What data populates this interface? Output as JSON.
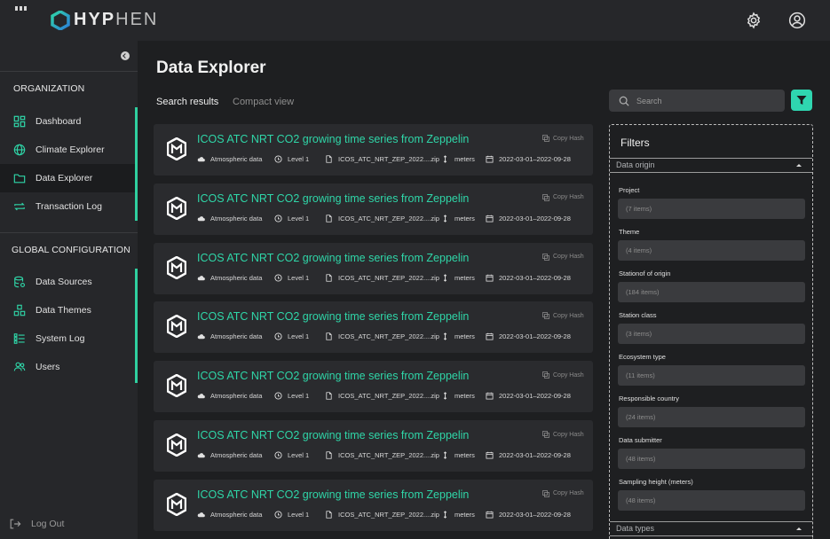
{
  "app": {
    "logo_bold": "HYP",
    "logo_light": "HEN"
  },
  "sidebar": {
    "sections": {
      "organization": "ORGANIZATION",
      "global": "GLOBAL CONFIGURATION"
    },
    "org_items": [
      {
        "label": "Dashboard",
        "icon": "dashboard-icon"
      },
      {
        "label": "Climate Explorer",
        "icon": "globe-icon"
      },
      {
        "label": "Data Explorer",
        "icon": "folder-icon",
        "active": true
      },
      {
        "label": "Transaction Log",
        "icon": "repeat-icon"
      }
    ],
    "config_items": [
      {
        "label": "Data Sources",
        "icon": "database-icon"
      },
      {
        "label": "Data Themes",
        "icon": "cubes-icon"
      },
      {
        "label": "System Log",
        "icon": "list-icon"
      },
      {
        "label": "Users",
        "icon": "users-icon"
      }
    ],
    "logout": "Log Out"
  },
  "main": {
    "title": "Data Explorer",
    "tabs": [
      {
        "label": "Search results",
        "active": true
      },
      {
        "label": "Compact view",
        "active": false
      }
    ],
    "search_placeholder": "Search"
  },
  "results": [
    {
      "title": "ICOS ATC NRT CO2 growing time series from Zeppelin",
      "copy": "Copy Hash",
      "category": "Atmospheric data",
      "level": "Level 1",
      "file": "ICOS_ATC_NRT_ZEP_2022....zip",
      "unit": "meters",
      "dates": "2022-03-01–2022-09-28"
    },
    {
      "title": "ICOS ATC NRT CO2 growing time series from Zeppelin",
      "copy": "Copy Hash",
      "category": "Atmospheric data",
      "level": "Level 1",
      "file": "ICOS_ATC_NRT_ZEP_2022....zip",
      "unit": "meters",
      "dates": "2022-03-01–2022-09-28"
    },
    {
      "title": "ICOS ATC NRT CO2 growing time series from Zeppelin",
      "copy": "Copy Hash",
      "category": "Atmospheric data",
      "level": "Level 1",
      "file": "ICOS_ATC_NRT_ZEP_2022....zip",
      "unit": "meters",
      "dates": "2022-03-01–2022-09-28"
    },
    {
      "title": "ICOS ATC NRT CO2 growing time series from Zeppelin",
      "copy": "Copy Hash",
      "category": "Atmospheric data",
      "level": "Level 1",
      "file": "ICOS_ATC_NRT_ZEP_2022....zip",
      "unit": "meters",
      "dates": "2022-03-01–2022-09-28"
    },
    {
      "title": "ICOS ATC NRT CO2 growing time series from Zeppelin",
      "copy": "Copy Hash",
      "category": "Atmospheric data",
      "level": "Level 1",
      "file": "ICOS_ATC_NRT_ZEP_2022....zip",
      "unit": "meters",
      "dates": "2022-03-01–2022-09-28"
    },
    {
      "title": "ICOS ATC NRT CO2 growing time series from Zeppelin",
      "copy": "Copy Hash",
      "category": "Atmospheric data",
      "level": "Level 1",
      "file": "ICOS_ATC_NRT_ZEP_2022....zip",
      "unit": "meters",
      "dates": "2022-03-01–2022-09-28"
    },
    {
      "title": "ICOS ATC NRT CO2 growing time series from Zeppelin",
      "copy": "Copy Hash",
      "category": "Atmospheric data",
      "level": "Level 1",
      "file": "ICOS_ATC_NRT_ZEP_2022....zip",
      "unit": "meters",
      "dates": "2022-03-01–2022-09-28"
    }
  ],
  "filters": {
    "title": "Filters",
    "groups": [
      {
        "label": "Data origin"
      },
      {
        "label": "Data types"
      }
    ],
    "fields": [
      {
        "label": "Project",
        "value": "(7 items)"
      },
      {
        "label": "Theme",
        "value": "(4 items)"
      },
      {
        "label": "Stationof of origin",
        "value": "(184 items)"
      },
      {
        "label": "Station class",
        "value": "(3 items)"
      },
      {
        "label": "Ecosystem type",
        "value": "(11 items)"
      },
      {
        "label": "Responsible country",
        "value": "(24 items)"
      },
      {
        "label": "Data submitter",
        "value": "(48 items)"
      },
      {
        "label": "Sampling height (meters)",
        "value": "(48 items)"
      }
    ]
  },
  "colors": {
    "accent": "#2fd6b0",
    "sidebar_bg": "#26272a",
    "main_bg": "#1e1f21",
    "card_bg": "#2a2b2e"
  }
}
